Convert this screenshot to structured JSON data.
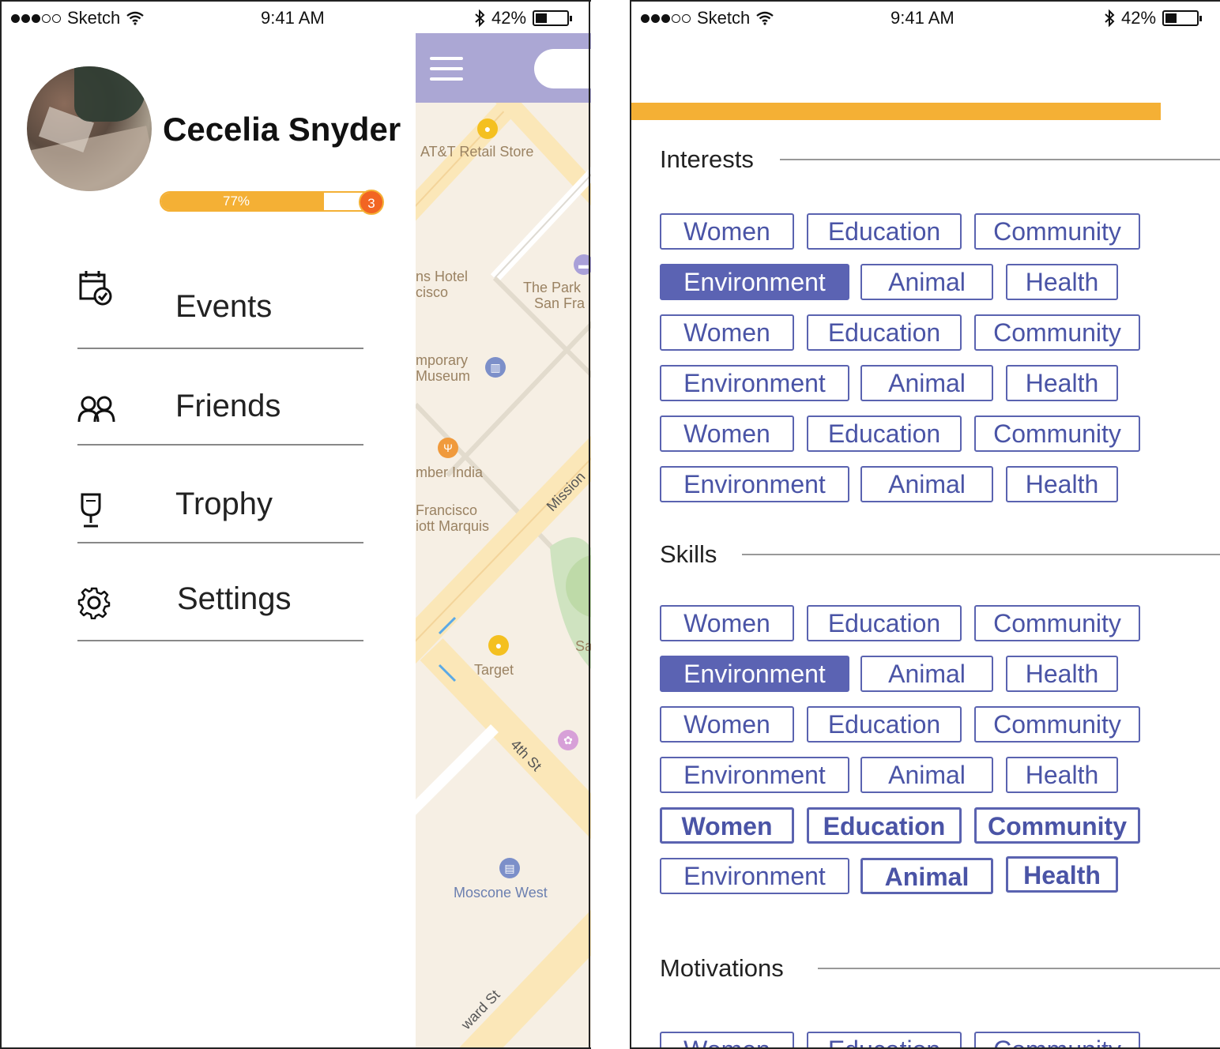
{
  "status_bar": {
    "carrier": "Sketch",
    "time": "9:41 AM",
    "battery": "42%",
    "battery_level": 0.42
  },
  "drawer": {
    "user_name": "Cecelia Snyder",
    "progress": {
      "label": "77%",
      "value": 0.77
    },
    "level": "3",
    "menu": [
      {
        "label": "Events",
        "icon": "calendar-check-icon"
      },
      {
        "label": "Friends",
        "icon": "friends-icon"
      },
      {
        "label": "Trophy",
        "icon": "trophy-icon"
      },
      {
        "label": "Settings",
        "icon": "gear-icon"
      }
    ]
  },
  "map": {
    "labels": [
      "AT&T Retail Store",
      "ns Hotel",
      "cisco",
      "The Park",
      "San Fra",
      "mporary",
      "Museum",
      "mber India",
      "Francisco",
      "iott Marquis",
      "Mission",
      "Target",
      "Sa",
      "4th St",
      "Moscone West",
      "ward St"
    ]
  },
  "profile": {
    "colors": {
      "accent": "#f4b035",
      "tag": "#5a63b0",
      "tag_selected_bg": "#5b63b3"
    },
    "sections": {
      "interests": "Interests",
      "skills": "Skills",
      "motivations": "Motivations"
    },
    "tags": {
      "women": "Women",
      "education": "Education",
      "community": "Community",
      "environment": "Environment",
      "animal": "Animal",
      "health": "Health"
    }
  }
}
